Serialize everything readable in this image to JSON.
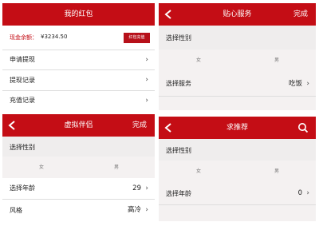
{
  "wallet": {
    "title": "我的红包",
    "balance_label": "现金余额：",
    "balance_value": "¥3234.50",
    "recharge_button": "红包充值",
    "menu": [
      "申请提现",
      "提现记录",
      "充值记录"
    ],
    "chevron": "›"
  },
  "service": {
    "title": "贴心服务",
    "action": "完成",
    "gender_label": "选择性别",
    "female": "女",
    "male": "男",
    "service_label": "选择服务",
    "service_value": "吃饭",
    "chevron": "›"
  },
  "companion": {
    "title": "虚拟伴侣",
    "action": "完成",
    "gender_label": "选择性别",
    "female": "女",
    "male": "男",
    "age_label": "选择年龄",
    "age_value": "29",
    "style_label": "风格",
    "style_value": "高冷",
    "chevron": "›"
  },
  "recommend": {
    "title": "求推荐",
    "gender_label": "选择性别",
    "female": "女",
    "male": "男",
    "age_label": "选择年龄",
    "age_value": "0",
    "chevron": "›"
  },
  "colors": {
    "brand_red": "#c40d15",
    "panel_bg": "#f4f1f1"
  },
  "icons": {
    "back": "back-arrow-icon",
    "search": "search-icon",
    "chevron": "chevron-right-icon"
  }
}
